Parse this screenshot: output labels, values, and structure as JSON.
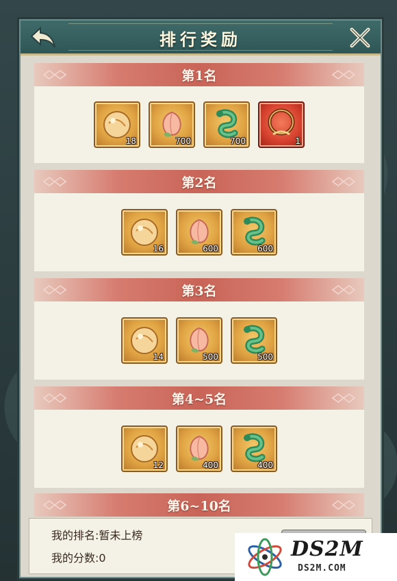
{
  "header": {
    "title": "排行奖励"
  },
  "tiers": [
    {
      "title": "第1名",
      "items": [
        {
          "icon": "orb-icon",
          "qty": "18"
        },
        {
          "icon": "peach-icon",
          "qty": "700"
        },
        {
          "icon": "jade-dragon-icon",
          "qty": "700"
        },
        {
          "icon": "flame-ring-icon",
          "qty": "1"
        }
      ]
    },
    {
      "title": "第2名",
      "items": [
        {
          "icon": "orb-icon",
          "qty": "16"
        },
        {
          "icon": "peach-icon",
          "qty": "600"
        },
        {
          "icon": "jade-dragon-icon",
          "qty": "600"
        }
      ]
    },
    {
      "title": "第3名",
      "items": [
        {
          "icon": "orb-icon",
          "qty": "14"
        },
        {
          "icon": "peach-icon",
          "qty": "500"
        },
        {
          "icon": "jade-dragon-icon",
          "qty": "500"
        }
      ]
    },
    {
      "title": "第4~5名",
      "items": [
        {
          "icon": "orb-icon",
          "qty": "12"
        },
        {
          "icon": "peach-icon",
          "qty": "400"
        },
        {
          "icon": "jade-dragon-icon",
          "qty": "400"
        }
      ]
    },
    {
      "title": "第6~10名",
      "items": []
    }
  ],
  "my_info": {
    "rank_line": "我的排名:暂未上榜",
    "score_line": "我的分数:0"
  },
  "watermark": {
    "main": "DS2M",
    "sub": "DS2M.COM"
  },
  "colors": {
    "tier_header": "#c96458",
    "panel_bg": "#dcd8ce",
    "title_bar": "#2f5656"
  }
}
